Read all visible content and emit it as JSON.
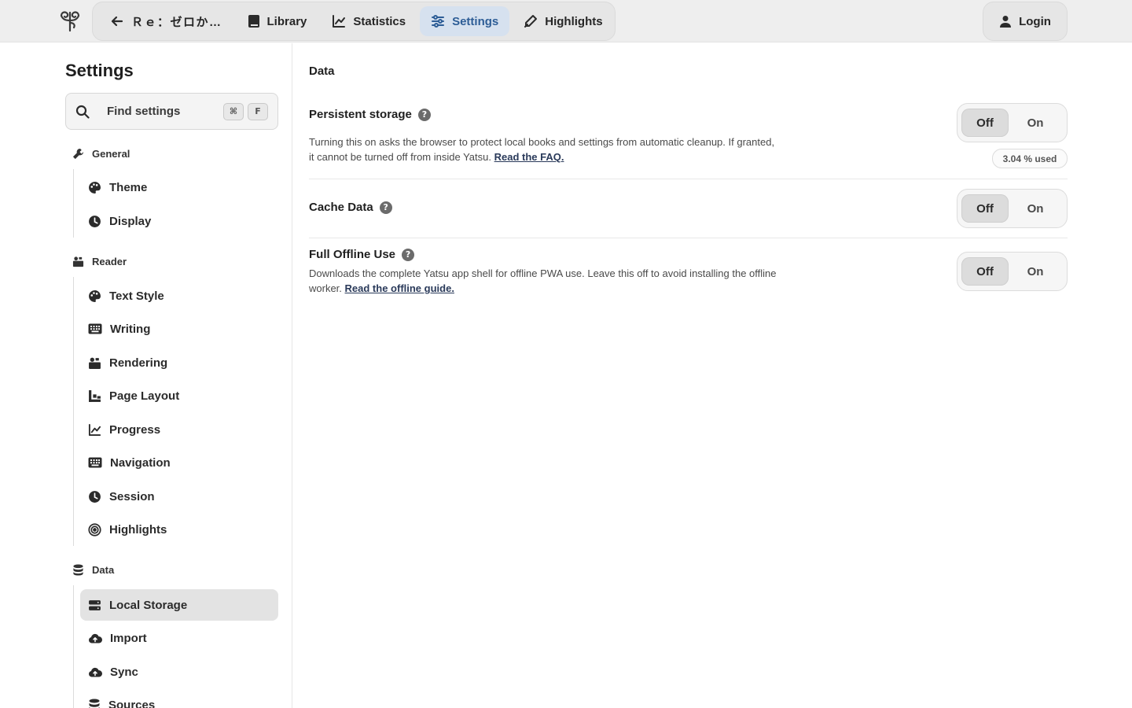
{
  "topbar": {
    "back_title": "Ｒｅ：ゼロか…",
    "nav": [
      {
        "label": "Library",
        "icon": "book-icon"
      },
      {
        "label": "Statistics",
        "icon": "chart-line-icon"
      },
      {
        "label": "Settings",
        "icon": "sliders-icon"
      },
      {
        "label": "Highlights",
        "icon": "pen-icon"
      }
    ],
    "active": "Settings",
    "login_label": "Login",
    "accent": "#2d5d96"
  },
  "sidebar": {
    "title": "Settings",
    "search_placeholder": "Find settings",
    "shortcut_keys": [
      "⌘",
      "F"
    ],
    "groups": [
      {
        "label": "General",
        "icon": "wrench-icon",
        "items": [
          {
            "label": "Theme",
            "icon": "palette-icon"
          },
          {
            "label": "Display",
            "icon": "clock-icon"
          }
        ]
      },
      {
        "label": "Reader",
        "icon": "reader-icon",
        "items": [
          {
            "label": "Text Style",
            "icon": "palette-icon"
          },
          {
            "label": "Writing",
            "icon": "keyboard-icon"
          },
          {
            "label": "Rendering",
            "icon": "rendering-icon"
          },
          {
            "label": "Page Layout",
            "icon": "layout-icon"
          },
          {
            "label": "Progress",
            "icon": "chart-line-icon"
          },
          {
            "label": "Navigation",
            "icon": "keyboard-icon"
          },
          {
            "label": "Session",
            "icon": "clock-icon"
          },
          {
            "label": "Highlights",
            "icon": "target-icon"
          }
        ]
      },
      {
        "label": "Data",
        "icon": "database-icon",
        "items": [
          {
            "label": "Local Storage",
            "icon": "hard-drive-icon"
          },
          {
            "label": "Import",
            "icon": "cloud-upload-icon"
          },
          {
            "label": "Sync",
            "icon": "cloud-upload-icon"
          },
          {
            "label": "Sources",
            "icon": "database-icon"
          }
        ]
      }
    ],
    "active_item": "Local Storage"
  },
  "main": {
    "section_title": "Data",
    "rows": [
      {
        "title": "Persistent storage",
        "help": "?",
        "desc": "Turning this on asks the browser to protect local books and settings from automatic cleanup. If granted, it cannot be turned off from inside Yatsu.",
        "link": "Read the FAQ.",
        "off_label": "Off",
        "on_label": "On",
        "value": "Off",
        "usage": "3.04 % used"
      },
      {
        "title": "Cache Data",
        "help": "?",
        "off_label": "Off",
        "on_label": "On",
        "value": "Off"
      },
      {
        "title": "Full Offline Use",
        "help": "?",
        "desc": "Downloads the complete Yatsu app shell for offline PWA use. Leave this off to avoid installing the offline worker.",
        "link": "Read the offline guide.",
        "off_label": "Off",
        "on_label": "On",
        "value": "Off"
      }
    ]
  }
}
